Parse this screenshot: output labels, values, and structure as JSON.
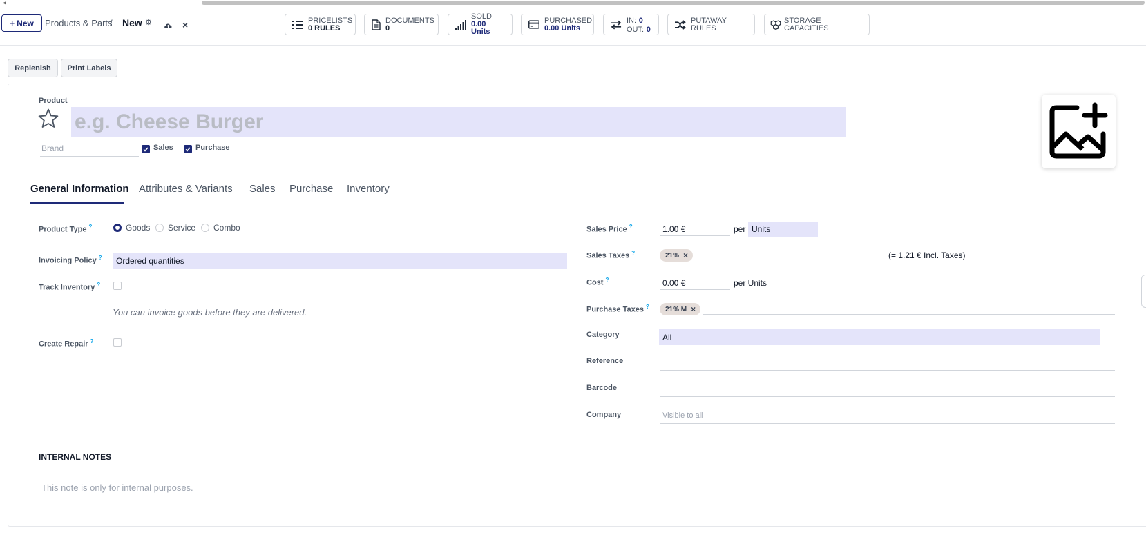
{
  "control_panel": {
    "new_label": "New",
    "breadcrumb_parent": "Products & Parts",
    "breadcrumb_separator": "/",
    "breadcrumb_current": "New"
  },
  "smart_buttons": {
    "pricelists": {
      "label": "PRICELISTS",
      "value": "0 RULES"
    },
    "documents": {
      "label": "DOCUMENTS",
      "value": "0"
    },
    "sold": {
      "label": "SOLD",
      "value": "0.00 Units"
    },
    "purchased": {
      "label": "PURCHASED",
      "value": "0.00 Units"
    },
    "in_out": {
      "in_label": "IN:",
      "in_value": "0",
      "out_label": "OUT:",
      "out_value": "0"
    },
    "putaway": {
      "label": "PUTAWAY RULES"
    },
    "storage": {
      "label": "STORAGE CAPACITIES"
    }
  },
  "actions": {
    "replenish": "Replenish",
    "print_labels": "Print Labels"
  },
  "product": {
    "label": "Product",
    "name_placeholder": "e.g. Cheese Burger",
    "brand_placeholder": "Brand",
    "sales_checkbox": "Sales",
    "purchase_checkbox": "Purchase"
  },
  "tabs": [
    "General Information",
    "Attributes & Variants",
    "Sales",
    "Purchase",
    "Inventory"
  ],
  "left": {
    "product_type": {
      "label": "Product Type",
      "options": [
        "Goods",
        "Service",
        "Combo"
      ],
      "selected": "Goods"
    },
    "invoicing_policy": {
      "label": "Invoicing Policy",
      "value": "Ordered quantities"
    },
    "track_inventory": {
      "label": "Track Inventory"
    },
    "hint": "You can invoice goods before they are delivered.",
    "create_repair": {
      "label": "Create Repair"
    }
  },
  "right": {
    "sales_price": {
      "label": "Sales Price",
      "value": "1.00 €",
      "per": "per",
      "uom": "Units"
    },
    "sales_taxes": {
      "label": "Sales Taxes",
      "tag": "21%",
      "incl": "(= 1.21 € Incl. Taxes)"
    },
    "cost": {
      "label": "Cost",
      "value": "0.00 €",
      "per": "per Units"
    },
    "purchase_taxes": {
      "label": "Purchase Taxes",
      "tag": "21% M"
    },
    "category": {
      "label": "Category",
      "value": "All"
    },
    "reference": {
      "label": "Reference"
    },
    "barcode": {
      "label": "Barcode"
    },
    "company": {
      "label": "Company",
      "placeholder": "Visible to all"
    }
  },
  "notes": {
    "title": "INTERNAL NOTES",
    "placeholder": "This note is only for internal purposes."
  },
  "colors": {
    "primary": "#1e2a78",
    "field_highlight": "#e4e4fa",
    "help": "#0ea5e9"
  }
}
